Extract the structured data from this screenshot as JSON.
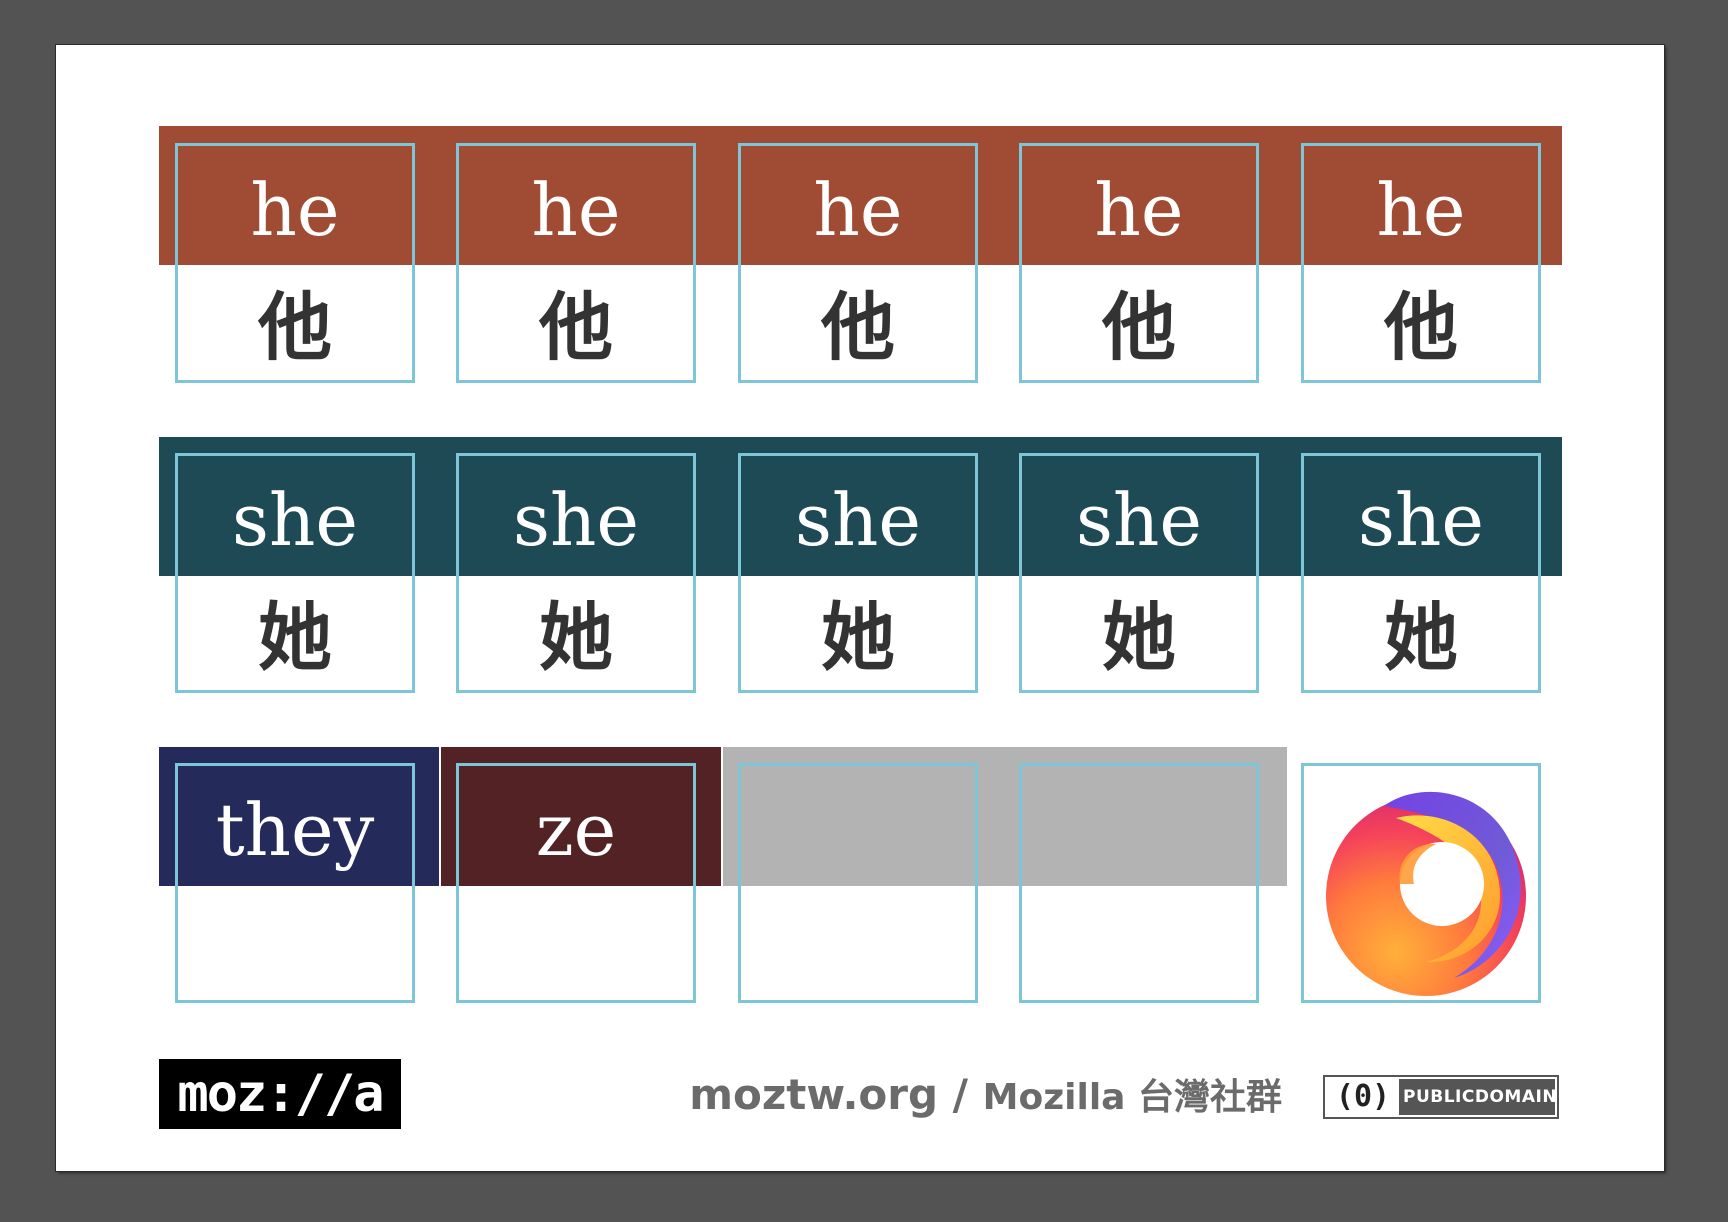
{
  "colors": {
    "he": "#a04b33",
    "she": "#1e4a56",
    "they": "#242a5a",
    "ze": "#522224",
    "blank": "#b3b3b3",
    "cell_border": "#7cc6d8"
  },
  "rows": [
    {
      "cells": [
        {
          "en": "he",
          "zh": "他"
        },
        {
          "en": "he",
          "zh": "他"
        },
        {
          "en": "he",
          "zh": "他"
        },
        {
          "en": "he",
          "zh": "他"
        },
        {
          "en": "he",
          "zh": "他"
        }
      ]
    },
    {
      "cells": [
        {
          "en": "she",
          "zh": "她"
        },
        {
          "en": "she",
          "zh": "她"
        },
        {
          "en": "she",
          "zh": "她"
        },
        {
          "en": "she",
          "zh": "她"
        },
        {
          "en": "she",
          "zh": "她"
        }
      ]
    },
    {
      "cells": [
        {
          "en": "they",
          "zh": ""
        },
        {
          "en": "ze",
          "zh": ""
        },
        {
          "en": "",
          "zh": ""
        },
        {
          "en": "",
          "zh": ""
        },
        {
          "icon": "firefox-logo-icon"
        }
      ]
    }
  ],
  "footer": {
    "brand": "moz://a",
    "site": "moztw.org",
    "separator": "/",
    "community": "Mozilla 台灣社群",
    "license_icon": "(0)",
    "license_text": "PUBLICDOMAIN"
  }
}
